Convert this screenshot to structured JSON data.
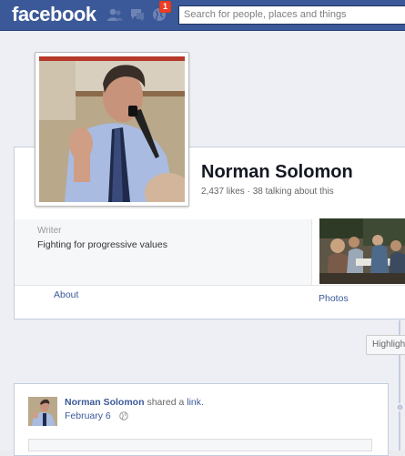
{
  "topbar": {
    "logo": "facebook",
    "notification_count": "1",
    "search_placeholder": "Search for people, places and things"
  },
  "page": {
    "name": "Norman Solomon",
    "stats": "2,437 likes · 38 talking about this",
    "category": "Writer",
    "about_text": "Fighting for progressive values",
    "tabs": {
      "about": "About",
      "photos": "Photos"
    },
    "highlights_button": "Highligh"
  },
  "post": {
    "author": "Norman Solomon",
    "action_text": "shared a",
    "link_text": "link.",
    "date": "February 6"
  },
  "colors": {
    "brand_blue": "#3b5998",
    "badge_red": "#f03d25",
    "page_bg": "#edeff4"
  },
  "icons": [
    "friend-requests-icon",
    "messages-icon",
    "notifications-globe-icon",
    "audience-globe-icon"
  ]
}
